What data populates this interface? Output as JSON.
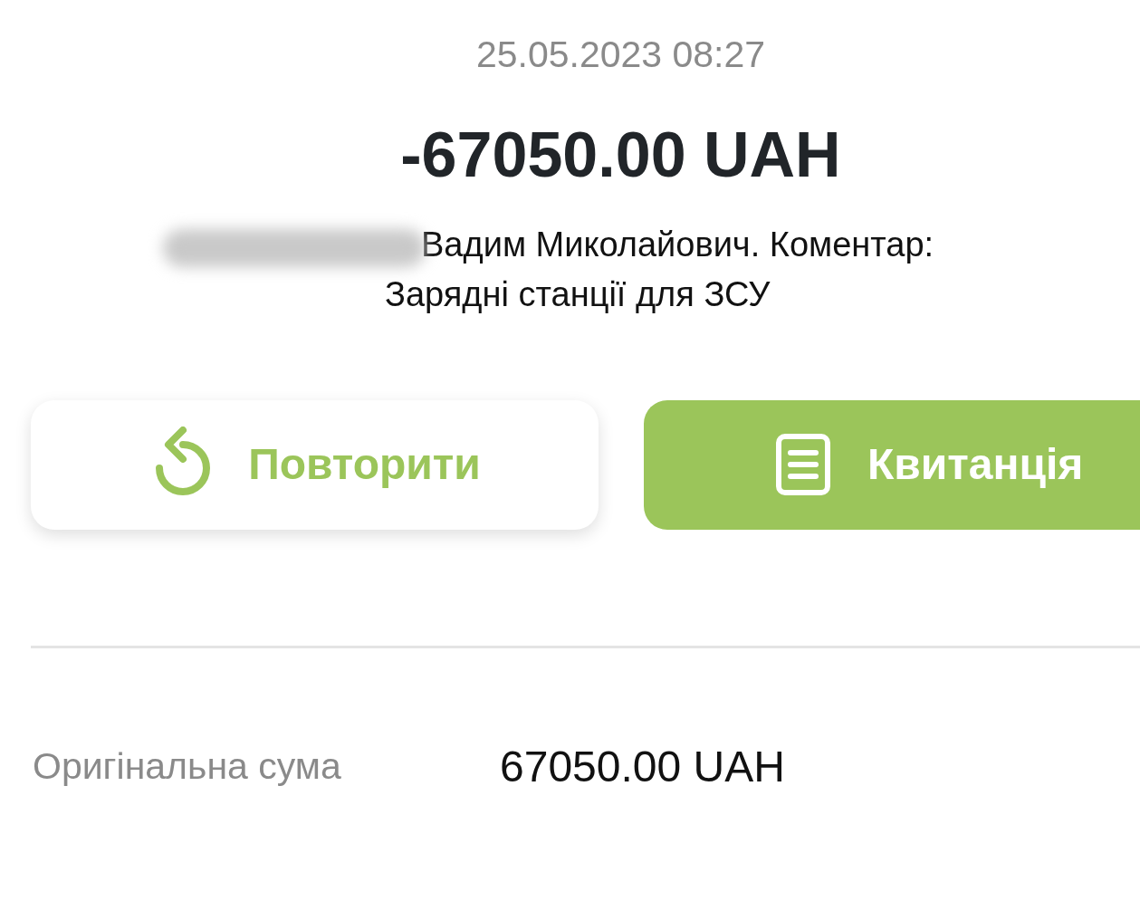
{
  "date": "25.05.2023 08:27",
  "amount": "-67050.00 UAH",
  "description": {
    "redacted": true,
    "text": "Вадим Миколайович. Коментар: Зарядні станції для ЗСУ"
  },
  "buttons": [
    {
      "kind": "repeat",
      "label": "Повторити"
    },
    {
      "kind": "receipt",
      "label": "Квитанція"
    }
  ],
  "details": [
    {
      "label": "Оригінальна сума",
      "value": "67050.00 UAH"
    }
  ]
}
